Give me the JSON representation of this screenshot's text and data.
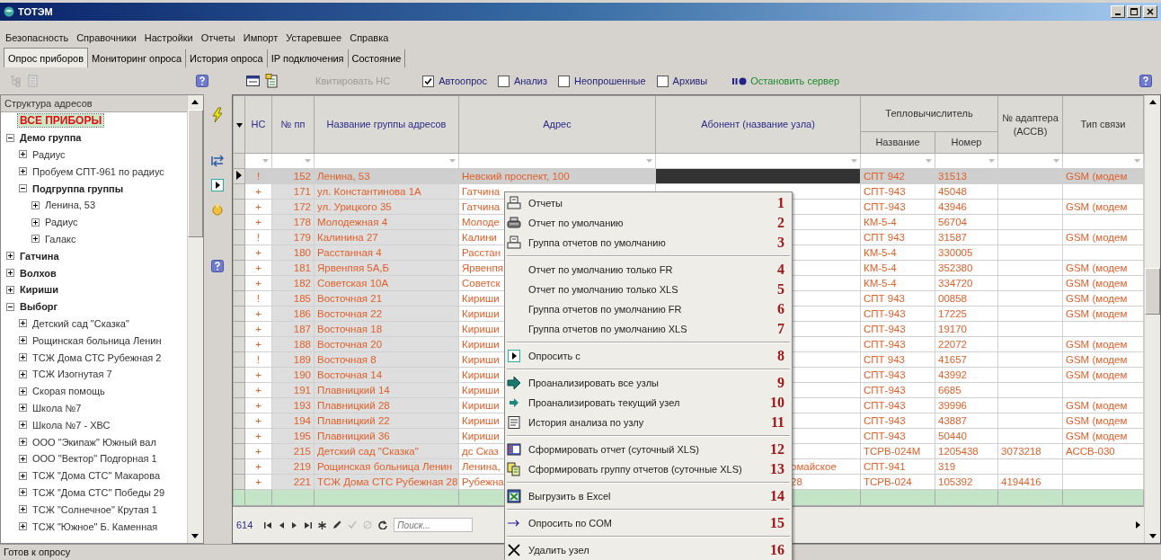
{
  "window": {
    "title": "ТОТЭМ"
  },
  "menu": [
    "Безопасность",
    "Справочники",
    "Настройки",
    "Отчеты",
    "Импорт",
    "Устаревшее",
    "Справка"
  ],
  "tabs": [
    {
      "label": "Опрос приборов",
      "selected": true
    },
    {
      "label": "Мониторинг опроса",
      "selected": false
    },
    {
      "label": "История опроса",
      "selected": false
    },
    {
      "label": "IP подключения",
      "selected": false
    },
    {
      "label": "Состояние",
      "selected": false
    }
  ],
  "toolbar": {
    "acknowledge": {
      "label": "Квитировать НС",
      "disabled": true
    },
    "checkboxes": [
      {
        "label": "Автоопрос",
        "checked": true
      },
      {
        "label": "Анализ",
        "checked": false
      },
      {
        "label": "Неопрошенные",
        "checked": false
      },
      {
        "label": "Архивы",
        "checked": false
      }
    ],
    "server_button": "Остановить сервер"
  },
  "tree": {
    "title": "Структура адресов",
    "items": [
      {
        "label": "ВСЕ ПРИБОРЫ",
        "kind": "all",
        "selected": true
      },
      {
        "label": "Демо группа",
        "kind": "group",
        "expanded": true,
        "selected": false,
        "children": [
          {
            "label": "Радиус",
            "kind": "node",
            "expanded": false,
            "selected": false
          },
          {
            "label": "Пробуем СПТ-961 по радиус",
            "kind": "node",
            "expanded": false,
            "selected": false
          },
          {
            "label": "Подгруппа группы",
            "kind": "group",
            "expanded": true,
            "selected": false,
            "children": [
              {
                "label": "Ленина, 53",
                "kind": "node",
                "expanded": false,
                "selected": false
              },
              {
                "label": "Радиус",
                "kind": "node",
                "expanded": false,
                "selected": false
              },
              {
                "label": "Галакс",
                "kind": "node",
                "expanded": false,
                "selected": false
              }
            ]
          }
        ]
      },
      {
        "label": "Гатчина",
        "kind": "group",
        "expanded": false,
        "selected": false
      },
      {
        "label": "Волхов",
        "kind": "group",
        "expanded": false,
        "selected": false
      },
      {
        "label": "Кириши",
        "kind": "group",
        "expanded": false,
        "selected": false
      },
      {
        "label": "Выборг",
        "kind": "group",
        "expanded": true,
        "selected": false,
        "children": [
          {
            "label": "Детский сад \"Сказка\"",
            "kind": "node",
            "expanded": false,
            "selected": false
          },
          {
            "label": "Рощинская больница Ленин",
            "kind": "node",
            "expanded": false,
            "selected": false
          },
          {
            "label": "ТСЖ Дома СТС Рубежная 2",
            "kind": "node",
            "expanded": false,
            "selected": false
          },
          {
            "label": "ТСЖ Изогнутая 7",
            "kind": "node",
            "expanded": false,
            "selected": false
          },
          {
            "label": "Скорая помощь",
            "kind": "node",
            "expanded": false,
            "selected": false
          },
          {
            "label": "Школа №7",
            "kind": "node",
            "expanded": false,
            "selected": false
          },
          {
            "label": "Школа №7 - ХВС",
            "kind": "node",
            "expanded": false,
            "selected": false
          },
          {
            "label": "ООО \"Экипаж\" Южный вал",
            "kind": "node",
            "expanded": false,
            "selected": false
          },
          {
            "label": "ООО \"Вектор\" Подгорная 1",
            "kind": "node",
            "expanded": false,
            "selected": false
          },
          {
            "label": "ТСЖ \"Дома СТС\" Макарова",
            "kind": "node",
            "expanded": false,
            "selected": false
          },
          {
            "label": "ТСЖ \"Дома СТС\" Победы 29",
            "kind": "node",
            "expanded": false,
            "selected": false
          },
          {
            "label": "ТСЖ \"Солнечное\" Крутая 1",
            "kind": "node",
            "expanded": false,
            "selected": false
          },
          {
            "label": "ТСЖ \"Южное\" Б. Каменная",
            "kind": "node",
            "expanded": false,
            "selected": false
          }
        ]
      }
    ]
  },
  "table": {
    "headers": {
      "nc": "НС",
      "number": "№ пп",
      "name": "Название группы адресов",
      "address": "Адрес",
      "subscriber": "Абонент (название узла)",
      "calculator": "Тепловычислитель",
      "calc_name": "Название",
      "calc_number": "Номер",
      "adapter": "№ адаптера (АССВ)",
      "link": "Тип связи"
    },
    "rows": [
      {
        "selected": true,
        "nc": "!",
        "number": "152",
        "name": "Ленина, 53",
        "address": "Невский проспект, 100",
        "calc_name": "СПТ 942",
        "calc_number": "31513",
        "link": "GSM (модем"
      },
      {
        "selected": false,
        "nc": "+",
        "number": "171",
        "name": "ул. Константинова 1А",
        "address": "Гатчина",
        "calc_name": "СПТ-943",
        "calc_number": "45048"
      },
      {
        "selected": false,
        "nc": "+",
        "number": "172",
        "name": "ул. Урицкого 35",
        "address": "Гатчина",
        "calc_name": "СПТ-943",
        "calc_number": "43946",
        "link": "GSM (модем"
      },
      {
        "selected": false,
        "nc": "+",
        "number": "178",
        "name": "Молодежная 4",
        "address": "Молоде",
        "calc_name": "КМ-5-4",
        "calc_number": "56704"
      },
      {
        "selected": false,
        "nc": "!",
        "number": "179",
        "name": "Калинина 27",
        "address": "Калини",
        "calc_name": "СПТ 943",
        "calc_number": "31587",
        "link": "GSM (модем"
      },
      {
        "selected": false,
        "nc": "+",
        "number": "180",
        "name": "Расстанная 4",
        "address": "Расстан",
        "calc_name": "КМ-5-4",
        "calc_number": "330005"
      },
      {
        "selected": false,
        "nc": "+",
        "number": "181",
        "name": "Ярвенпяя 5А,Б",
        "address": "Ярвенпя",
        "calc_name": "КМ-5-4",
        "calc_number": "352380",
        "link": "GSM (модем"
      },
      {
        "selected": false,
        "nc": "+",
        "number": "182",
        "name": "Советская 10А",
        "address": "Советск",
        "calc_name": "КМ-5-4",
        "calc_number": "334720",
        "link": "GSM (модем"
      },
      {
        "selected": false,
        "nc": "!",
        "number": "185",
        "name": "Восточная 21",
        "address": "Кириши",
        "calc_name": "СПТ 943",
        "calc_number": "00858",
        "link": "GSM (модем"
      },
      {
        "selected": false,
        "nc": "+",
        "number": "186",
        "name": "Восточная 22",
        "address": "Кириши",
        "calc_name": "СПТ-943",
        "calc_number": "17225",
        "link": "GSM (модем"
      },
      {
        "selected": false,
        "nc": "+",
        "number": "187",
        "name": "Восточная 18",
        "address": "Кириши",
        "calc_name": "СПТ-943",
        "calc_number": "19170"
      },
      {
        "selected": false,
        "nc": "+",
        "number": "188",
        "name": "Восточная 20",
        "address": "Кириши",
        "calc_name": "СПТ-943",
        "calc_number": "22072",
        "link": "GSM (модем"
      },
      {
        "selected": false,
        "nc": "!",
        "number": "189",
        "name": "Восточная 8",
        "address": "Кириши",
        "calc_name": "СПТ 943",
        "calc_number": "41657",
        "link": "GSM (модем"
      },
      {
        "selected": false,
        "nc": "+",
        "number": "190",
        "name": "Восточная 14",
        "address": "Кириши",
        "calc_name": "СПТ-943",
        "calc_number": "43992",
        "link": "GSM (модем"
      },
      {
        "selected": false,
        "nc": "+",
        "number": "191",
        "name": "Плавницкий 14",
        "address": "Кириши",
        "calc_name": "СПТ-943",
        "calc_number": "6685"
      },
      {
        "selected": false,
        "nc": "+",
        "number": "193",
        "name": "Плавницкий 28",
        "address": "Кириши",
        "calc_name": "СПТ-943",
        "calc_number": "39996",
        "link": "GSM (модем"
      },
      {
        "selected": false,
        "nc": "+",
        "number": "194",
        "name": "Плавницкий 22",
        "address": "Кириши",
        "calc_name": "СПТ-943",
        "calc_number": "43887",
        "link": "GSM (модем"
      },
      {
        "selected": false,
        "nc": "+",
        "number": "195",
        "name": "Плавницкий 36",
        "address": "Кириши",
        "calc_name": "СПТ-943",
        "calc_number": "50440",
        "link": "GSM (модем"
      },
      {
        "selected": false,
        "nc": "+",
        "number": "215",
        "name": "Детский сад \"Сказка\"",
        "address": "дс Сказ",
        "calc_name": "ТСРВ-024М",
        "calc_number": "1205438",
        "adapter": "3073218",
        "link": "АССВ-030"
      },
      {
        "selected": false,
        "nc": "+",
        "number": "219",
        "name": "Рощинская больница Ленин",
        "address": "Ленина,",
        "subscriber": "омайское",
        "calc_name": "СПТ-941",
        "calc_number": "319"
      },
      {
        "selected": false,
        "nc": "+",
        "number": "221",
        "name": "ТСЖ Дома СТС Рубежная 28",
        "address": "Рубежна",
        "subscriber": "28",
        "calc_name": "ТСРВ-024",
        "calc_number": "105392",
        "adapter": "4194416"
      }
    ],
    "record_count": "614",
    "search_placeholder": "Поиск..."
  },
  "context_menu": {
    "groups": [
      [
        {
          "kind": "report",
          "label": "Отчеты",
          "number": "1"
        },
        {
          "kind": "printer",
          "label": "Отчет по умолчанию",
          "number": "2"
        },
        {
          "kind": "report",
          "label": "Группа отчетов по умолчанию",
          "number": "3"
        }
      ],
      [
        {
          "kind": "plain",
          "label": "Отчет по умолчанию только FR",
          "number": "4"
        },
        {
          "kind": "plain",
          "label": "Отчет по умолчанию только XLS",
          "number": "5"
        },
        {
          "kind": "plain",
          "label": "Группа отчетов по умолчанию FR",
          "number": "6"
        },
        {
          "kind": "plain",
          "label": "Группа отчетов по умолчанию XLS",
          "number": "7"
        }
      ],
      [
        {
          "kind": "play",
          "label": "Опросить с",
          "number": "8"
        }
      ],
      [
        {
          "kind": "big-arrow",
          "label": "Проанализировать все узлы",
          "number": "9"
        },
        {
          "kind": "arrow",
          "label": "Проанализировать текущий узел",
          "number": "10"
        },
        {
          "kind": "history",
          "label": "История анализа по узлу",
          "number": "11"
        }
      ],
      [
        {
          "kind": "xls",
          "label": "Сформировать отчет (суточный XLS)",
          "number": "12"
        },
        {
          "kind": "xls-group",
          "label": "Сформировать группу отчетов (суточные XLS)",
          "number": "13"
        }
      ],
      [
        {
          "kind": "excel",
          "label": "Выгрузить в Excel",
          "number": "14"
        }
      ],
      [
        {
          "kind": "line-arrow",
          "label": "Опросить по COM",
          "number": "15"
        }
      ],
      [
        {
          "kind": "cross",
          "label": "Удалить узел",
          "number": "16"
        }
      ]
    ]
  },
  "status_bar": "Готов к опросу"
}
